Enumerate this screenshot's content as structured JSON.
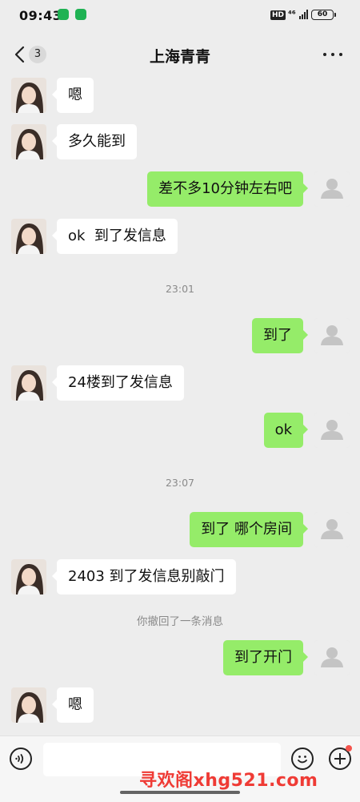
{
  "status_bar": {
    "time": "09:43",
    "hd": "HD",
    "signal": "⁴⁶",
    "battery": "60"
  },
  "header": {
    "back_count": "3",
    "title": "上海青青"
  },
  "messages": [
    {
      "side": "in",
      "text": "嗯"
    },
    {
      "side": "in",
      "text": "多久能到"
    },
    {
      "side": "out",
      "text": "差不多10分钟左右吧"
    },
    {
      "side": "in",
      "text": "ok  到了发信息"
    },
    {
      "side": "time",
      "text": "23:01"
    },
    {
      "side": "out",
      "text": "到了"
    },
    {
      "side": "in",
      "text": "24楼到了发信息"
    },
    {
      "side": "out",
      "text": "ok"
    },
    {
      "side": "time",
      "text": "23:07"
    },
    {
      "side": "out",
      "text": "到了 哪个房间"
    },
    {
      "side": "in",
      "text": "2403 到了发信息别敲门"
    },
    {
      "side": "system",
      "text": "你撤回了一条消息"
    },
    {
      "side": "out",
      "text": "到了开门"
    },
    {
      "side": "in",
      "text": "嗯"
    }
  ],
  "input": {
    "value": ""
  },
  "watermark": "寻欢阁xhg521.com",
  "colors": {
    "background": "#ededed",
    "outgoing_bubble": "#95ec69",
    "incoming_bubble": "#ffffff",
    "badge_dot": "#f5544d"
  }
}
